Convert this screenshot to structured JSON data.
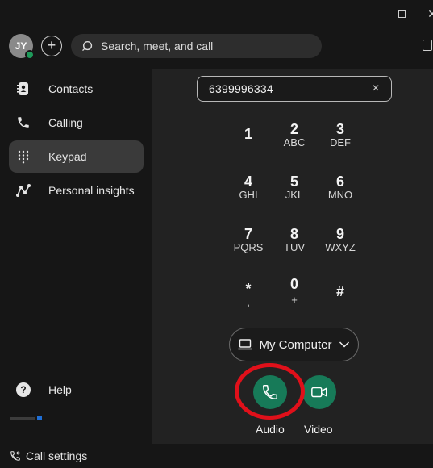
{
  "window": {
    "minimize_glyph": "—",
    "close_glyph": "✕"
  },
  "header": {
    "avatar_initials": "JY",
    "presence_color": "#1e9a5a",
    "add_glyph": "+",
    "search_placeholder": "Search, meet, and call"
  },
  "sidebar": {
    "items": [
      {
        "label": "Contacts",
        "icon": "contacts-icon"
      },
      {
        "label": "Calling",
        "icon": "phone-icon"
      },
      {
        "label": "Keypad",
        "icon": "keypad-icon",
        "active": true
      },
      {
        "label": "Personal insights",
        "icon": "insights-icon"
      }
    ],
    "help_label": "Help",
    "help_glyph": "?",
    "call_settings_label": "Call settings"
  },
  "dialpad": {
    "number": "6399996334",
    "clear_glyph": "×",
    "keys": [
      {
        "digit": "1",
        "letters": ""
      },
      {
        "digit": "2",
        "letters": "ABC"
      },
      {
        "digit": "3",
        "letters": "DEF"
      },
      {
        "digit": "4",
        "letters": "GHI"
      },
      {
        "digit": "5",
        "letters": "JKL"
      },
      {
        "digit": "6",
        "letters": "MNO"
      },
      {
        "digit": "7",
        "letters": "PQRS"
      },
      {
        "digit": "8",
        "letters": "TUV"
      },
      {
        "digit": "9",
        "letters": "WXYZ"
      },
      {
        "digit": "*",
        "letters": ","
      },
      {
        "digit": "0",
        "letters": "+"
      },
      {
        "digit": "#",
        "letters": ""
      }
    ]
  },
  "device": {
    "label": "My Computer"
  },
  "actions": {
    "audio_label": "Audio",
    "video_label": "Video",
    "accent_color": "#177a58",
    "highlight_ring_color": "#e0101a"
  }
}
